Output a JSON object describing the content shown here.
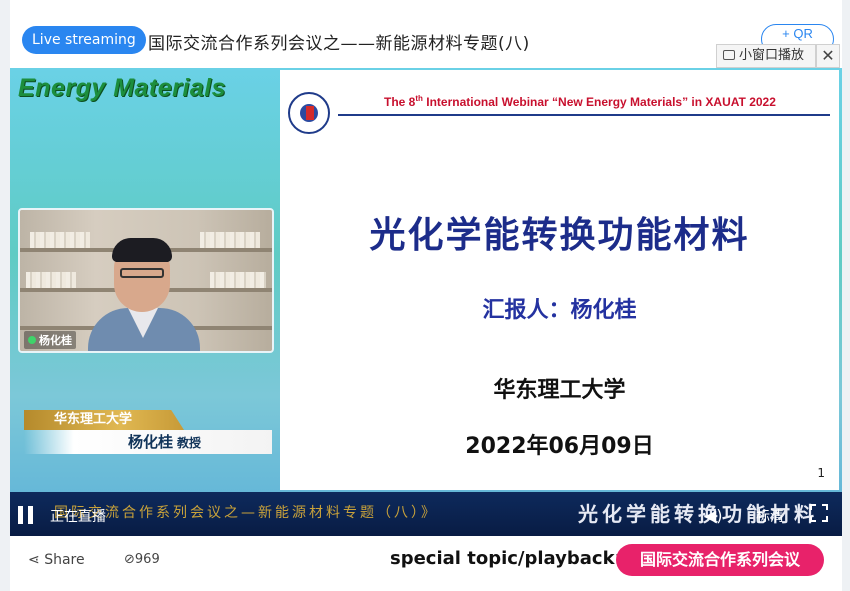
{
  "header": {
    "live_badge": "Live streaming",
    "title": "国际交流合作系列会议之——新能源材料专题(八)",
    "qr_label": "+ QR",
    "mini_window_label": "小窗口播放",
    "close_label": "✕"
  },
  "video": {
    "brand_title": "Energy Materials",
    "speaker_cam_label": "杨化桂",
    "banner_school": "华东理工大学",
    "banner_name": "杨化桂",
    "banner_role": "教授",
    "slide": {
      "header_pre": "The 8",
      "header_sup": "th",
      "header_post": " International Webinar “New Energy Materials” in XAUAT 2022",
      "main_title": "光化学能转换功能材料",
      "reporter": "汇报人：杨化桂",
      "university": "华东理工大学",
      "date": "2022年06月09日",
      "page_number": "1"
    },
    "controls": {
      "live_status": "正在直播",
      "ticker": "国际交流合作系列会议之—新能源材料专题（八）》",
      "ticker_right": "光化学能转换功能材料",
      "quality": "标清"
    }
  },
  "footer": {
    "share_label": "Share",
    "views": "969",
    "special_label": "special topic/playback:",
    "topic_button": "国际交流合作系列会议"
  }
}
